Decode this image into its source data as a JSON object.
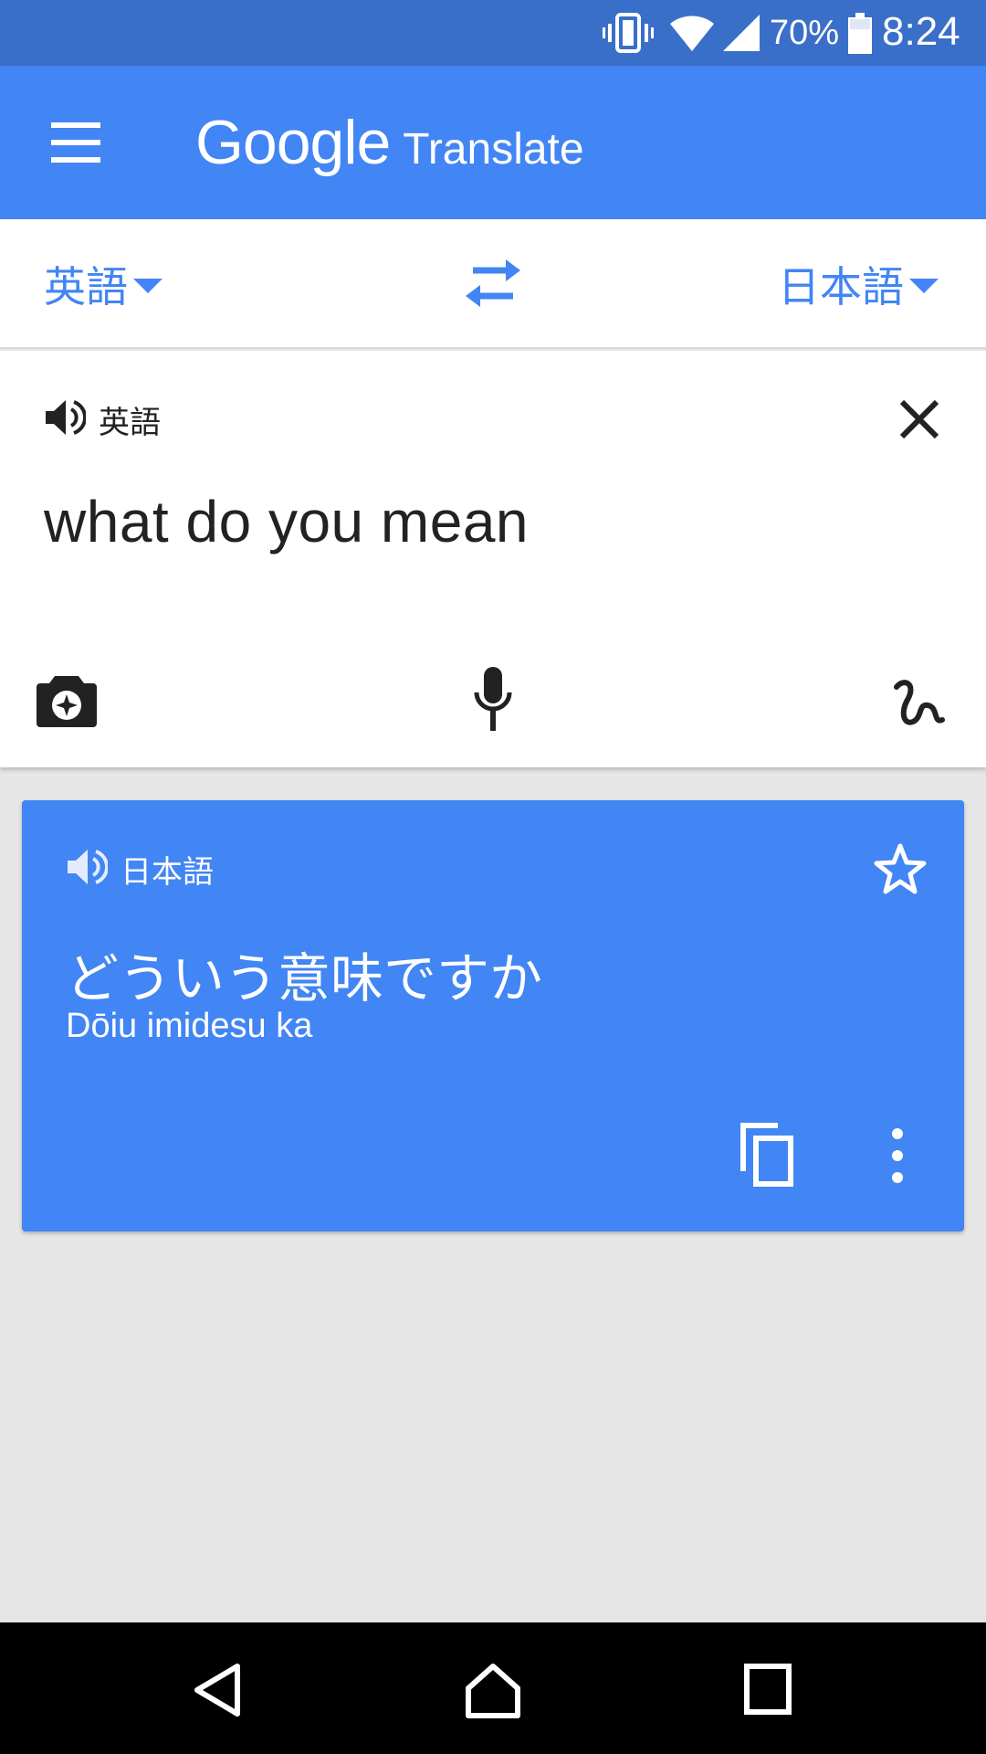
{
  "status_bar": {
    "battery_percent": "70%",
    "time": "8:24",
    "icons": [
      "vibrate-icon",
      "wifi-icon",
      "signal-icon",
      "battery-icon"
    ]
  },
  "app_bar": {
    "brand": "Google",
    "product": "Translate",
    "menu_icon": "hamburger-menu-icon"
  },
  "language_bar": {
    "source_language": "英語",
    "target_language": "日本語",
    "swap_icon": "swap-arrows-icon"
  },
  "input": {
    "language_label": "英語",
    "text": "what do you mean",
    "tools": [
      "camera-icon",
      "microphone-icon",
      "handwriting-icon"
    ]
  },
  "result": {
    "language_label": "日本語",
    "translation": "どういう意味ですか",
    "transliteration": "Dōiu imidesu ka",
    "actions": [
      "star-icon",
      "copy-icon",
      "more-vert-icon"
    ]
  },
  "navigation": {
    "buttons": [
      "back-icon",
      "home-icon",
      "recents-icon"
    ]
  },
  "colors": {
    "accent": "#4285f4",
    "status_bar": "#3a6fc9",
    "background": "#e6e6e6"
  }
}
